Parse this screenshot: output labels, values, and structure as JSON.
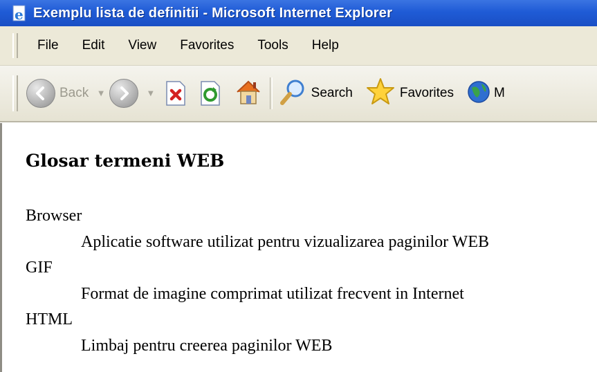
{
  "window": {
    "title": "Exemplu lista de definitii - Microsoft Internet Explorer",
    "icon": "ie-page-icon"
  },
  "menubar": {
    "items": [
      "File",
      "Edit",
      "View",
      "Favorites",
      "Tools",
      "Help"
    ]
  },
  "toolbar": {
    "back_label": "Back",
    "search_label": "Search",
    "favorites_label": "Favorites",
    "media_label": "M"
  },
  "page": {
    "heading": "Glosar termeni WEB",
    "definitions": [
      {
        "term": "Browser",
        "description": "Aplicatie software utilizat pentru vizualizarea paginilor WEB"
      },
      {
        "term": "GIF",
        "description": "Format de imagine comprimat utilizat frecvent in Internet"
      },
      {
        "term": "HTML",
        "description": "Limbaj pentru creerea paginilor WEB"
      }
    ]
  },
  "colors": {
    "titlebar": "#1f5bd6",
    "chrome": "#ece9d8",
    "content_bg": "#ffffff"
  }
}
